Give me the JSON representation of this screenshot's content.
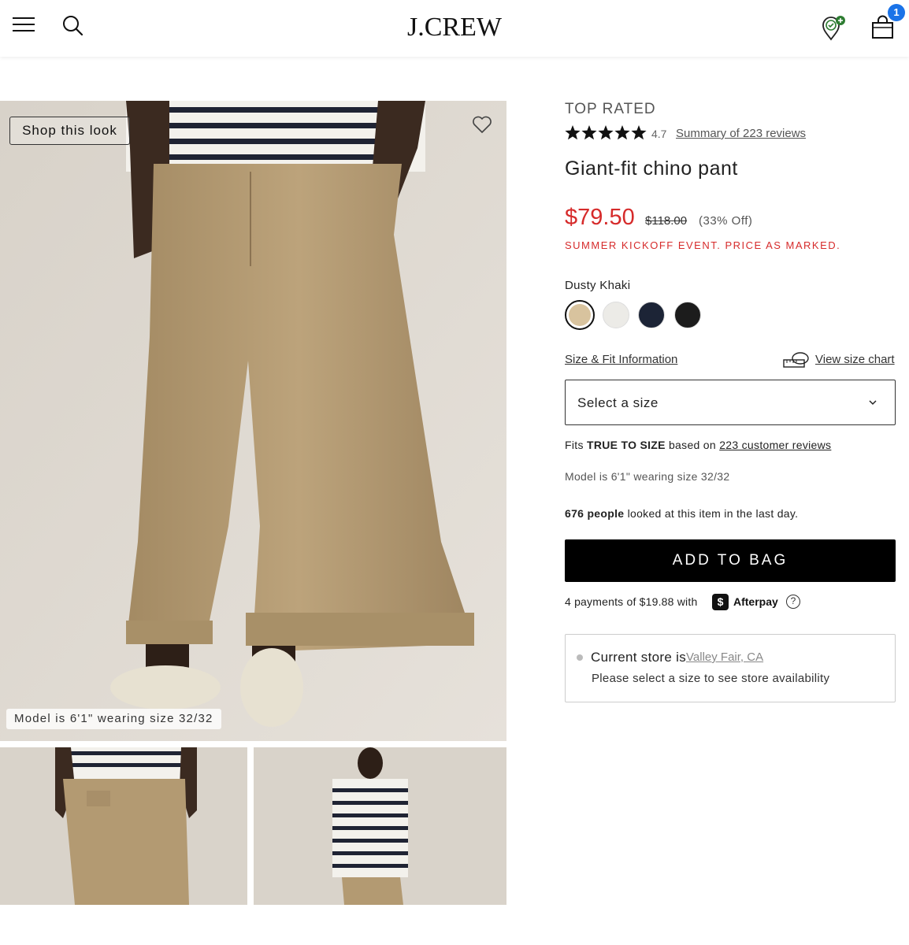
{
  "header": {
    "logo": "J.CREW",
    "bag_count": "1"
  },
  "gallery": {
    "shop_look_label": "Shop this look",
    "model_caption": "Model is 6'1\" wearing size 32/32"
  },
  "product": {
    "badge": "TOP RATED",
    "rating": "4.7",
    "rating_stars": 4.7,
    "reviews_link": "Summary of 223 reviews",
    "name": "Giant-fit chino pant",
    "price_sale": "$79.50",
    "price_original": "$118.00",
    "price_off": "(33% Off)",
    "promo": "SUMMER KICKOFF EVENT. PRICE AS MARKED.",
    "color_name": "Dusty Khaki",
    "swatches": [
      {
        "name": "Dusty Khaki",
        "color": "#d8c39e",
        "selected": true
      },
      {
        "name": "white",
        "color": "#ecebe7",
        "selected": false
      },
      {
        "name": "navy",
        "color": "#1c2436",
        "selected": false
      },
      {
        "name": "black",
        "color": "#1c1c1c",
        "selected": false
      }
    ],
    "size_fit_link": "Size & Fit Information",
    "size_chart_link": "View size chart",
    "size_select": "Select a size",
    "fits_prefix": "Fits",
    "fits_value": "TRUE TO SIZE",
    "fits_middle": "based on",
    "fits_link": "223 customer reviews",
    "model_line": "Model is 6'1\" wearing size 32/32",
    "people_count": "676 people",
    "people_suffix": "looked at this item in the last day.",
    "add_to_bag": "ADD TO BAG",
    "afterpay_text": "4 payments of $19.88 with",
    "afterpay_icon": "$",
    "afterpay_name": "Afterpay",
    "afterpay_help": "?",
    "store_label": "Current store is",
    "store_name": "Valley Fair, CA",
    "store_hint": "Please select a size to see store availability"
  },
  "colors": {
    "sale_red": "#d62b2b",
    "bag_badge": "#1a73e8",
    "khaki": "#b39a72"
  }
}
